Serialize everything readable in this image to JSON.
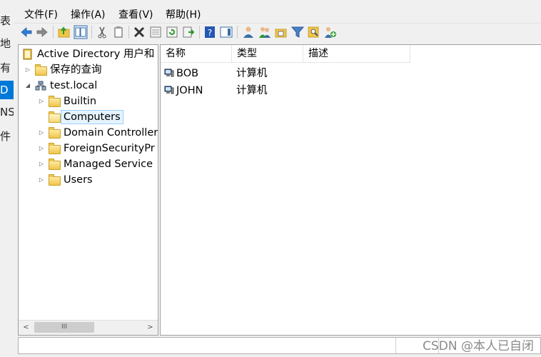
{
  "background_window": {
    "fragments": [
      "表",
      "地",
      "有",
      "D",
      "NS",
      "件"
    ]
  },
  "menu": {
    "items": [
      "文件(F)",
      "操作(A)",
      "查看(V)",
      "帮助(H)"
    ]
  },
  "toolbar": {
    "icons": [
      "back-arrow-icon",
      "forward-arrow-icon",
      "up-folder-icon",
      "show-console-tree-icon",
      "cut-icon",
      "copy-icon",
      "delete-icon",
      "properties-icon",
      "refresh-icon",
      "export-list-icon",
      "help-icon",
      "action-pane-icon",
      "new-user-icon",
      "new-group-icon",
      "new-ou-icon",
      "filter-icon",
      "find-icon",
      "add-to-group-icon"
    ]
  },
  "tree": {
    "root": "Active Directory 用户和",
    "saved_queries": "保存的查询",
    "domain": "test.local",
    "children": [
      "Builtin",
      "Computers",
      "Domain Controller",
      "ForeignSecurityPr",
      "Managed Service",
      "Users"
    ],
    "selected": "Computers"
  },
  "list": {
    "columns": [
      "名称",
      "类型",
      "描述"
    ],
    "rows": [
      {
        "name": "BOB",
        "type": "计算机",
        "desc": ""
      },
      {
        "name": "JOHN",
        "type": "计算机",
        "desc": ""
      }
    ]
  },
  "scrollbar": {
    "left_arrow": "<",
    "right_arrow": ">",
    "thumb_grip": "III"
  },
  "watermark": "CSDN @本人已自闭",
  "colors": {
    "selection_bg": "#e5f3ff",
    "selection_border": "#99d1ff",
    "accent_blue": "#0078d7",
    "folder_yellow": "#f0c54a"
  }
}
